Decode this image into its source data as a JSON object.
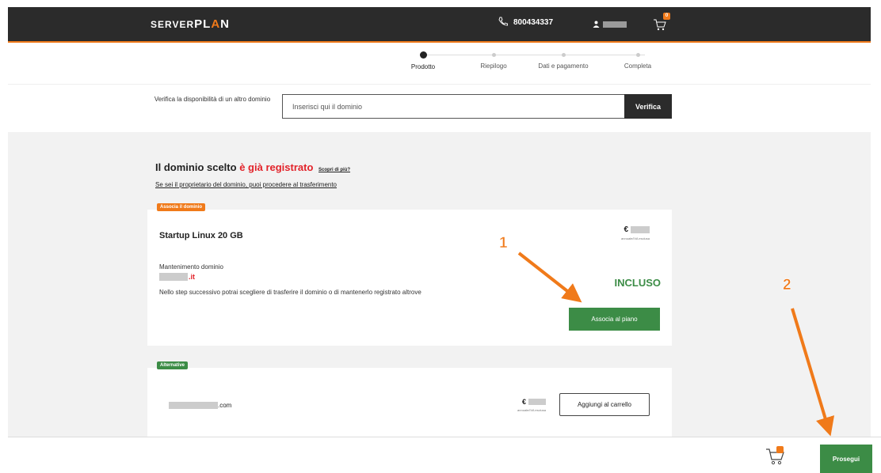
{
  "header": {
    "logo_prefix": "SERVER",
    "logo_word": "PL",
    "logo_a": "A",
    "logo_suffix": "N",
    "phone": "800434337",
    "cart_count": "0",
    "accent": "#f07a1a",
    "background": "#2b2b2b"
  },
  "stepper": {
    "steps": [
      {
        "label": "Prodotto",
        "active": true
      },
      {
        "label": "Riepilogo",
        "active": false
      },
      {
        "label": "Dati e pagamento",
        "active": false
      },
      {
        "label": "Completa",
        "active": false
      }
    ]
  },
  "search": {
    "label": "Verifica la disponibilità di un altro dominio",
    "placeholder": "Inserisci qui il dominio",
    "button": "Verifica"
  },
  "main": {
    "headline_prefix": "Il dominio scelto",
    "headline_status": "è già registrato",
    "headline_link": "Scopri di più?",
    "transfer_link": "Se sei il proprietario del dominio, puoi procedere al trasferimento"
  },
  "plan_card": {
    "tag": "Associa il dominio",
    "name": "Startup Linux 20 GB",
    "currency": "€",
    "price_note": "annuale/IVA esclusa",
    "maintenance_label": "Mantenimento dominio",
    "domain_ext": ".it",
    "note": "Nello step successivo potrai scegliere di trasferire il dominio o di mantenerlo registrato altrove",
    "included_label": "INCLUSO",
    "button": "Associa al piano"
  },
  "alt_card": {
    "tag": "Alternative",
    "domain_ext": ".com",
    "currency": "€",
    "price_note": "annuale/IVA esclusa",
    "button": "Aggiungi al carrello"
  },
  "footer": {
    "cart_count": "0",
    "button": "Prosegui"
  },
  "annotations": {
    "marker_1": "1",
    "marker_2": "2",
    "color": "#f07a1a"
  },
  "colors": {
    "green": "#3c8c46",
    "red": "#e2232a",
    "grey_bg": "#f2f2f2"
  }
}
